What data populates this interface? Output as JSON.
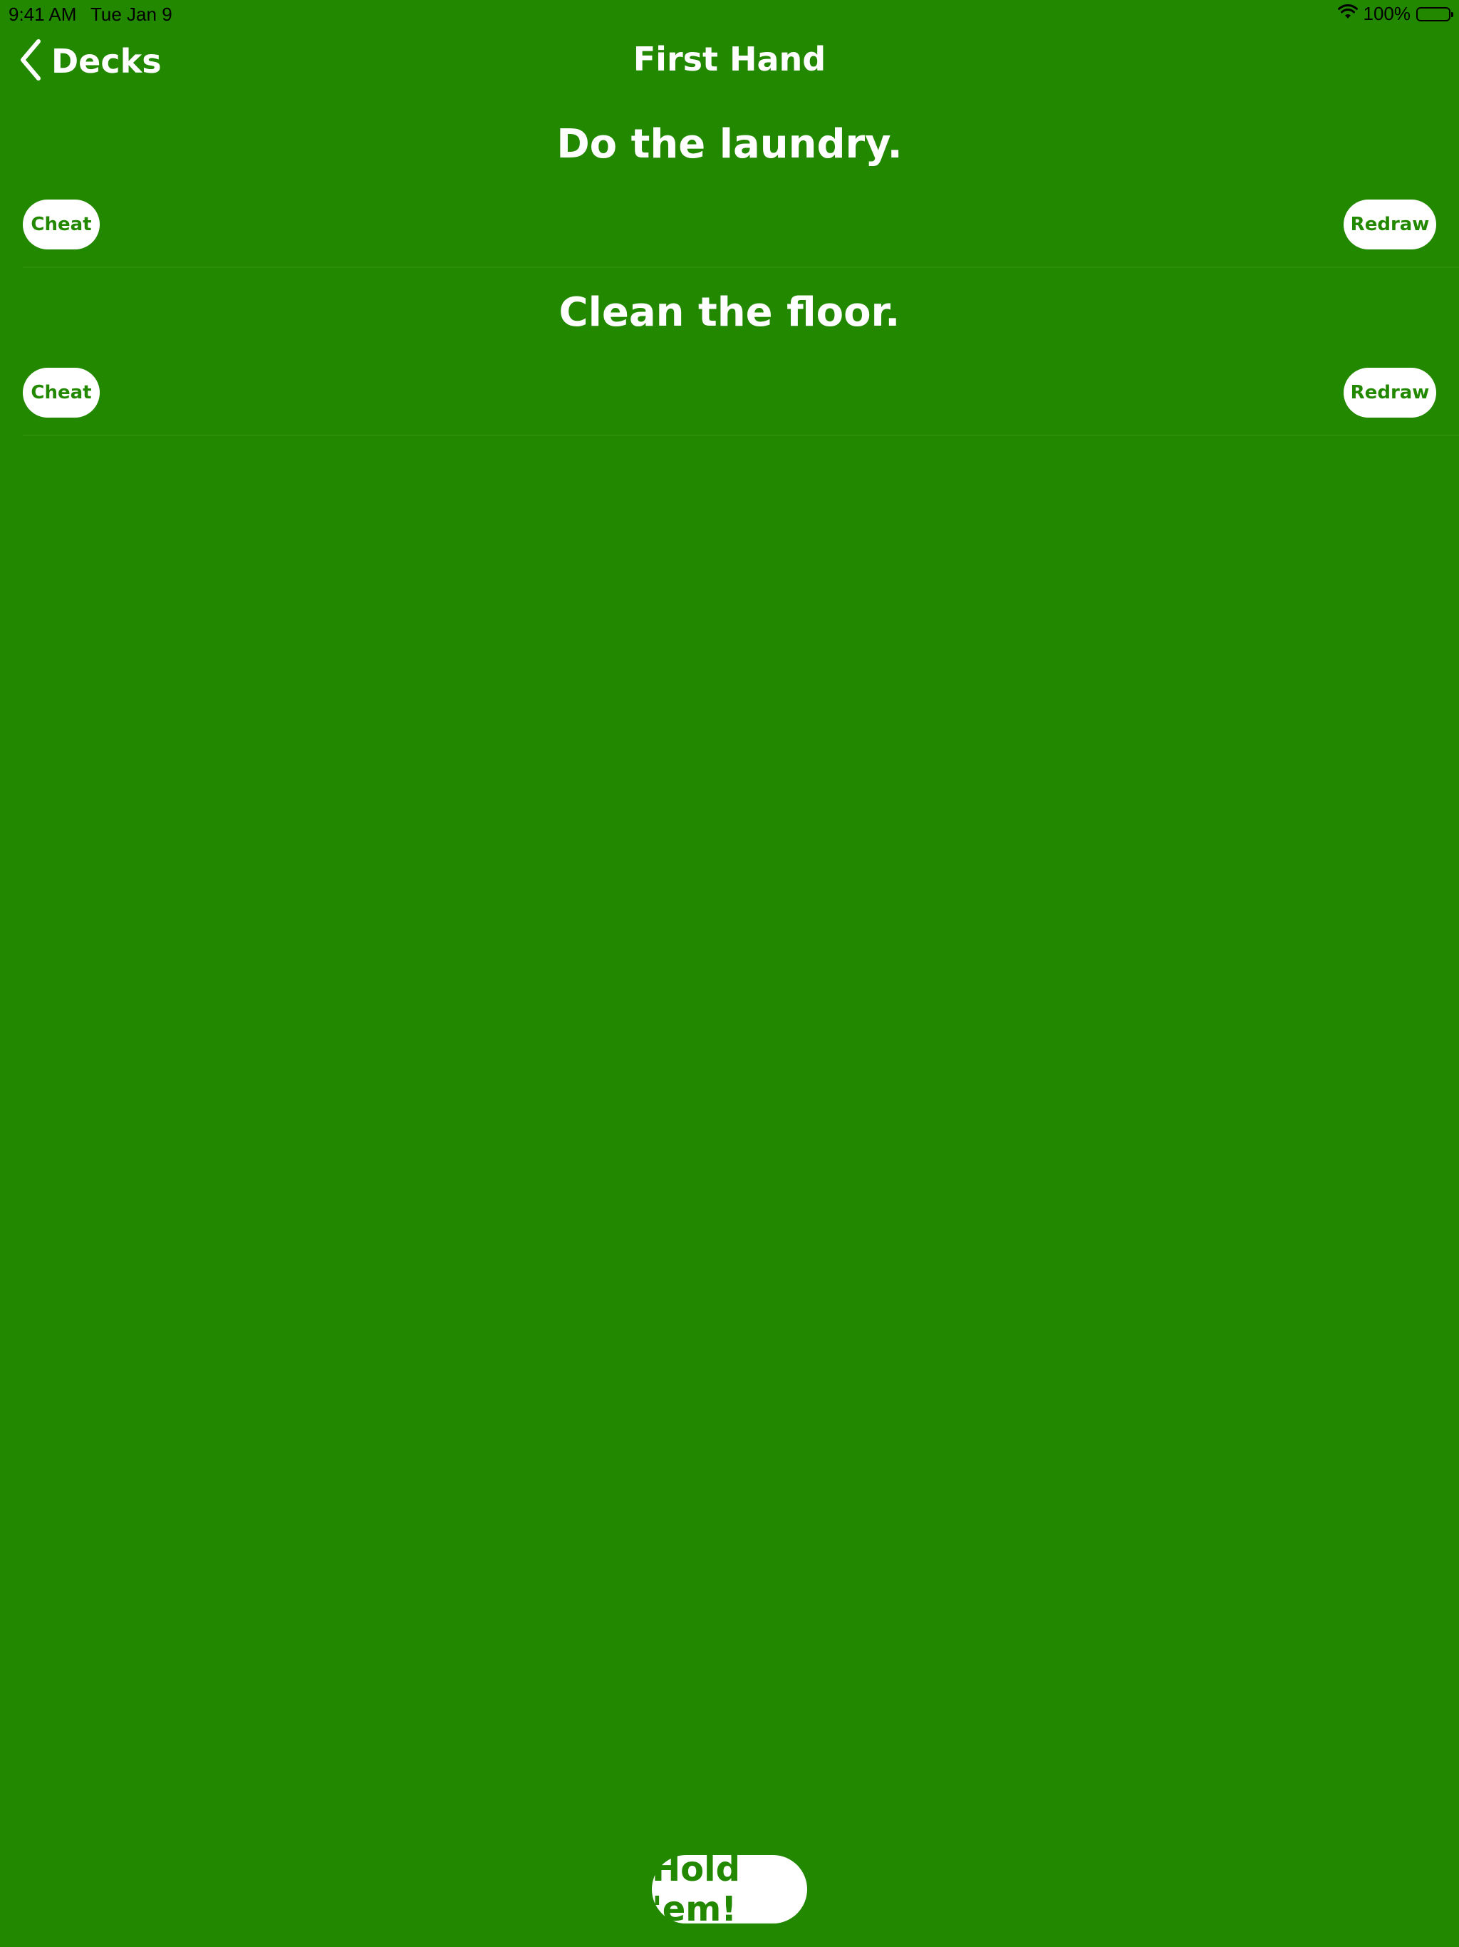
{
  "status_bar": {
    "time": "9:41 AM",
    "date": "Tue Jan 9",
    "battery_text": "100%",
    "icons": [
      "wifi-icon",
      "battery-icon"
    ]
  },
  "nav": {
    "back_label": "Decks",
    "title": "First Hand",
    "back_icon": "chevron-left-icon"
  },
  "cards": [
    {
      "text": "Do the laundry.",
      "cheat_label": "Cheat",
      "redraw_label": "Redraw"
    },
    {
      "text": "Clean the floor.",
      "cheat_label": "Cheat",
      "redraw_label": "Redraw"
    }
  ],
  "footer": {
    "hold_label": "Hold 'em!"
  },
  "colors": {
    "background": "#228800",
    "button_background": "#ffffff",
    "button_text": "#228800",
    "text": "#ffffff"
  }
}
